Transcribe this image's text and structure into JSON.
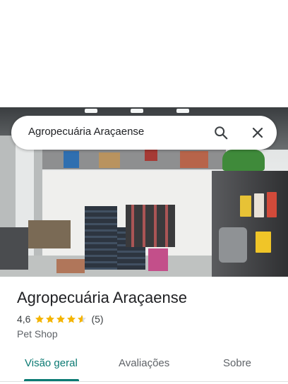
{
  "search": {
    "query": "Agropecuária Araçaense"
  },
  "place": {
    "name": "Agropecuária Araçaense",
    "rating": "4,6",
    "stars": 4.6,
    "review_count": "(5)",
    "category": "Pet Shop"
  },
  "tabs": [
    {
      "label": "Visão geral",
      "active": true
    },
    {
      "label": "Avaliações",
      "active": false
    },
    {
      "label": "Sobre",
      "active": false
    }
  ],
  "colors": {
    "accent": "#0b7a73",
    "star": "#f4b400"
  }
}
